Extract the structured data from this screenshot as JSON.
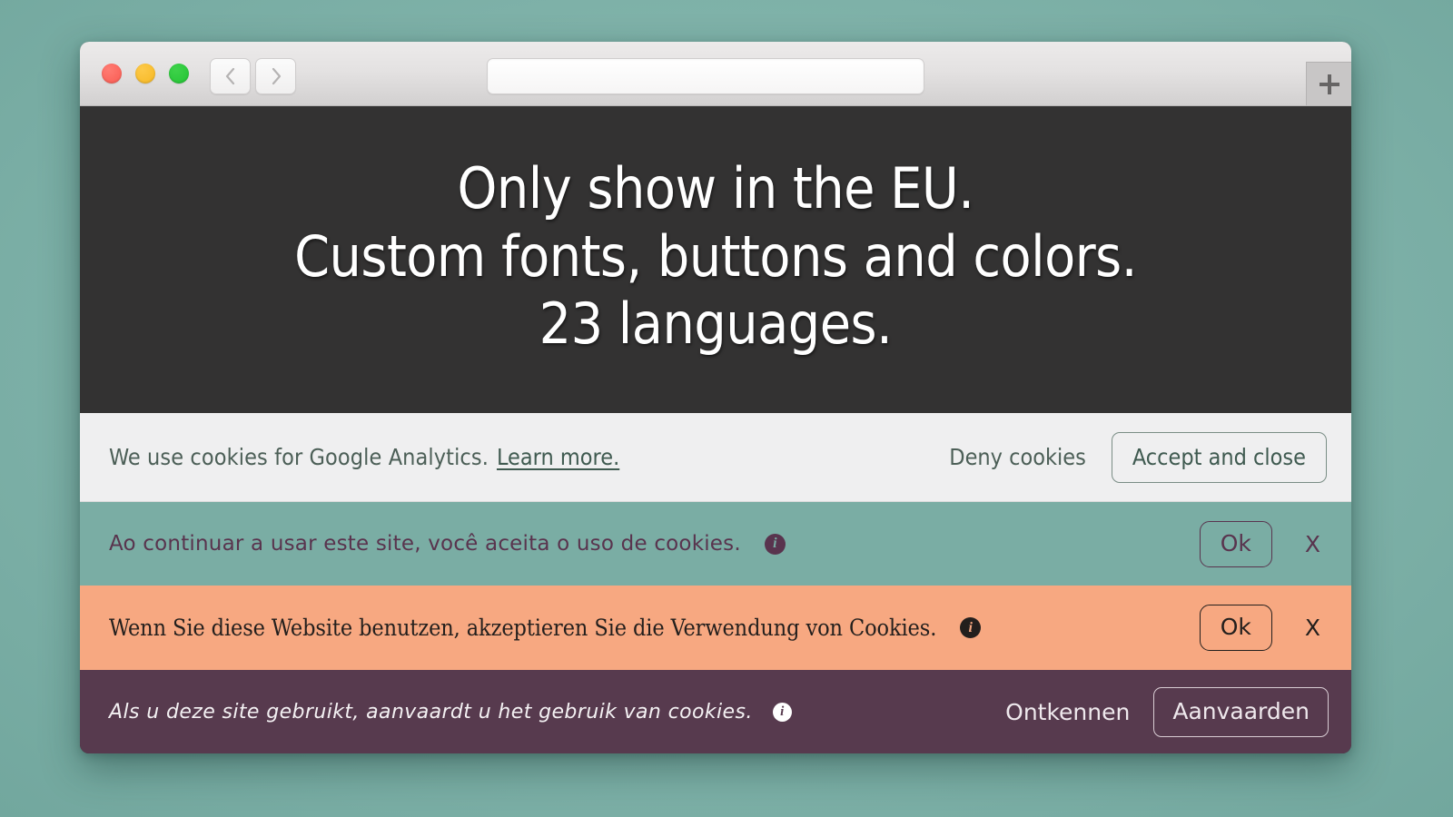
{
  "browser": {
    "traffic_lights": [
      "close",
      "minimize",
      "maximize"
    ],
    "back_label": "Back",
    "forward_label": "Forward",
    "url_value": "",
    "url_placeholder": "",
    "new_tab_label": "+"
  },
  "hero": {
    "lines": [
      "Only show in the EU.",
      "Custom fonts, buttons and colors.",
      "23 languages."
    ],
    "background_color": "#333232",
    "text_color": "#ffffff"
  },
  "banners": [
    {
      "id": "google-analytics",
      "language": "English",
      "message": "We use cookies for Google Analytics.",
      "link_label": "Learn more.",
      "deny_label": "Deny cookies",
      "accept_label": "Accept and close",
      "background_color": "#efeff0",
      "text_color": "#4c5f57"
    },
    {
      "id": "portuguese",
      "language": "Portuguese",
      "message": "Ao continuar a usar este site, você aceita o uso de cookies.",
      "info_icon": "info-icon",
      "ok_label": "Ok",
      "close_label": "X",
      "background_color": "#7aada4",
      "text_color": "#59344e"
    },
    {
      "id": "german",
      "language": "German",
      "message": "Wenn Sie diese Website benutzen, akzeptieren Sie die Verwendung von Cookies.",
      "info_icon": "info-icon",
      "ok_label": "Ok",
      "close_label": "X",
      "background_color": "#f7a881",
      "text_color": "#231f1d"
    },
    {
      "id": "dutch",
      "language": "Dutch",
      "message": "Als u deze site gebruikt, aanvaardt u het gebruik van cookies.",
      "info_icon": "info-icon",
      "deny_label": "Ontkennen",
      "accept_label": "Aanvaarden",
      "background_color": "#573a4e",
      "text_color": "#f4f1f3"
    }
  ],
  "page": {
    "background_color": "#7fb2a9"
  }
}
